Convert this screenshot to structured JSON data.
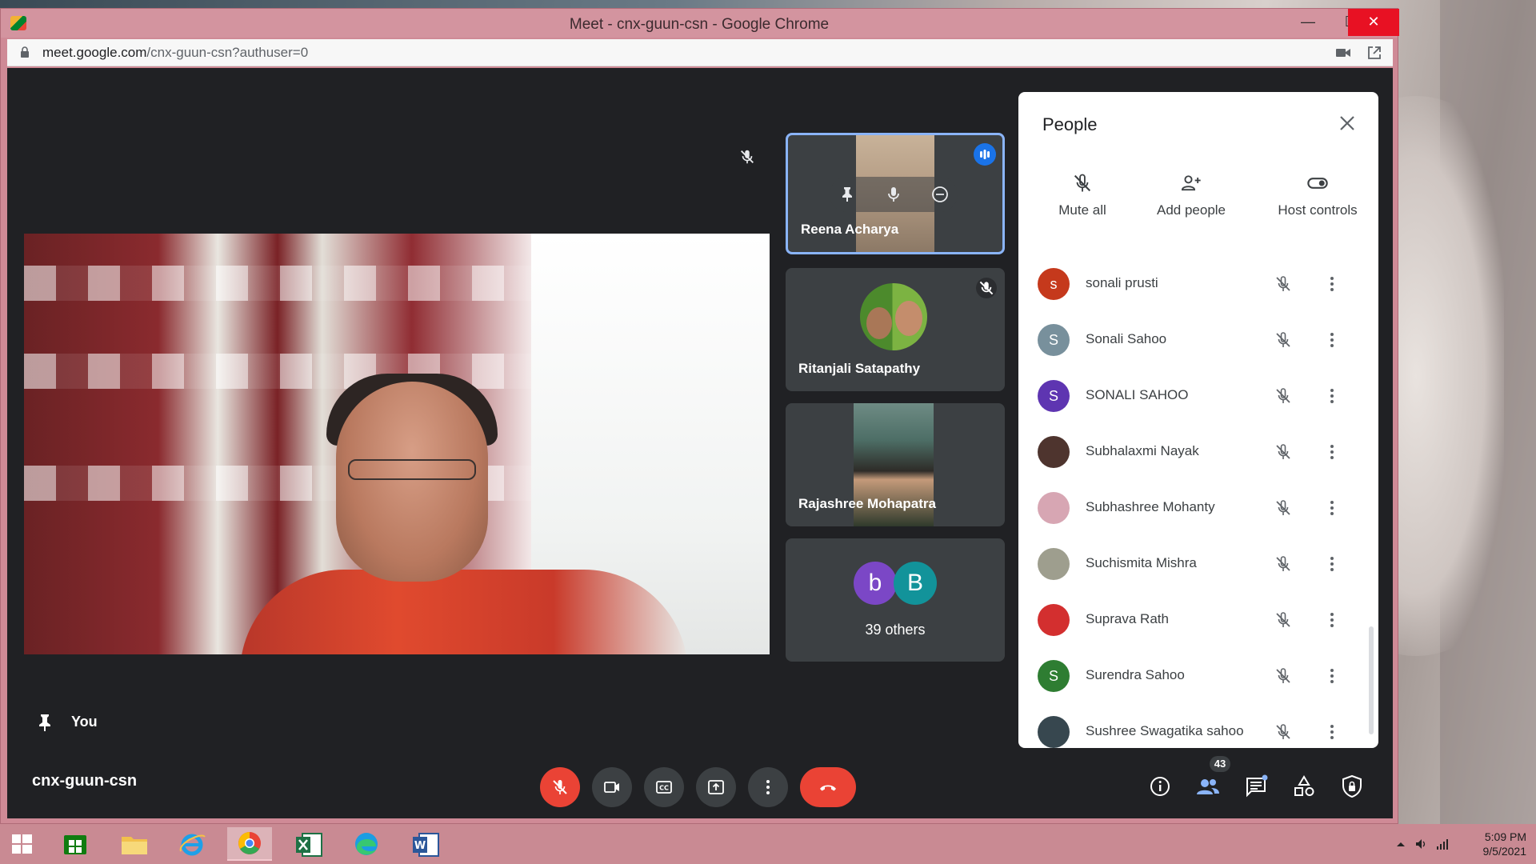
{
  "window": {
    "title": "Meet - cnx-guun-csn - Google Chrome",
    "minimize": "—",
    "maximize": "☐",
    "close": "✕"
  },
  "address": {
    "host": "meet.google.com",
    "path": "/cnx-guun-csn?authuser=0"
  },
  "meet": {
    "you_label": "You",
    "meeting_code": "cnx-guun-csn",
    "tiles": {
      "reena": "Reena Acharya",
      "ritanjali": "Ritanjali Satapathy",
      "rajashree": "Rajashree Mohapatra",
      "others_count": "39 others",
      "others_avatar_1": "b",
      "others_avatar_2": "B"
    },
    "people_badge": "43"
  },
  "people_panel": {
    "title": "People",
    "actions": {
      "mute_all": "Mute all",
      "add_people": "Add people",
      "host_controls": "Host controls"
    },
    "participants": [
      {
        "name": "sonali prusti",
        "initial": "s",
        "color": "#c5391c"
      },
      {
        "name": "Sonali Sahoo",
        "initial": "S",
        "color": "#78909c"
      },
      {
        "name": "SONALI SAHOO",
        "initial": "S",
        "color": "#5e35b1"
      },
      {
        "name": "Subhalaxmi Nayak",
        "initial": "",
        "color": "#4e342e"
      },
      {
        "name": "Subhashree Mohanty",
        "initial": "",
        "color": "#d7a6b3"
      },
      {
        "name": "Suchismita Mishra",
        "initial": "",
        "color": "#9e9e8e"
      },
      {
        "name": "Suprava Rath",
        "initial": "",
        "color": "#d32f2f"
      },
      {
        "name": "Surendra Sahoo",
        "initial": "S",
        "color": "#2e7d32"
      },
      {
        "name": "Sushree Swagatika sahoo",
        "initial": "",
        "color": "#37474f"
      }
    ]
  },
  "tray": {
    "time": "5:09 PM",
    "date": "9/5/2021"
  },
  "colors": {
    "meet_bg": "#202124",
    "end_call": "#ea4335",
    "active_tile_border": "#8ab4f8",
    "speaking_indicator": "#1a73e8"
  }
}
